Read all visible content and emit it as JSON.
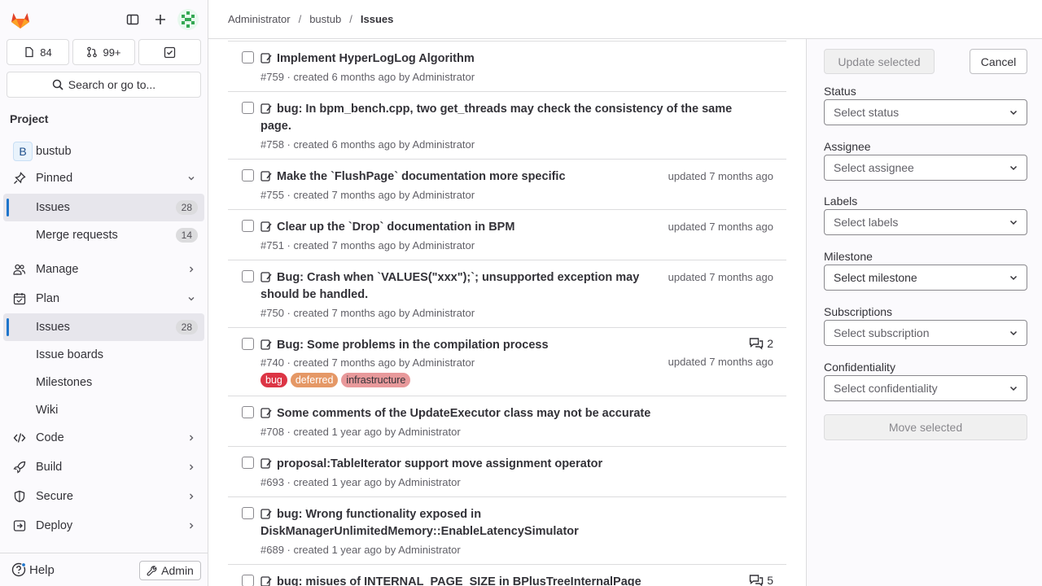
{
  "breadcrumb": {
    "items": [
      "Administrator",
      "bustub"
    ],
    "current": "Issues"
  },
  "counts": {
    "issues": "84",
    "merge_requests": "99+"
  },
  "search": {
    "label": "Search or go to..."
  },
  "sidebar": {
    "section_label": "Project",
    "project": {
      "avatar_letter": "B",
      "name": "bustub"
    },
    "pinned": {
      "label": "Pinned",
      "items": [
        {
          "label": "Issues",
          "count": "28"
        },
        {
          "label": "Merge requests",
          "count": "14"
        }
      ]
    },
    "manage": "Manage",
    "plan": {
      "label": "Plan",
      "items": [
        {
          "label": "Issues",
          "count": "28"
        },
        {
          "label": "Issue boards"
        },
        {
          "label": "Milestones"
        },
        {
          "label": "Wiki"
        }
      ]
    },
    "code": "Code",
    "build": "Build",
    "secure": "Secure",
    "deploy": "Deploy",
    "help": "Help",
    "admin": "Admin"
  },
  "issues": [
    {
      "title": "Implement HyperLogLog Algorithm",
      "meta": "#759 · created 6 months ago by Administrator"
    },
    {
      "title": "bug: In bpm_bench.cpp, two get_threads may check the consistency of the same page.",
      "meta": "#758 · created 6 months ago by Administrator"
    },
    {
      "title": "Make the `FlushPage` documentation more specific",
      "meta": "#755 · created 7 months ago by Administrator",
      "updated": "updated 7 months ago"
    },
    {
      "title": "Clear up the `Drop` documentation in BPM",
      "meta": "#751 · created 7 months ago by Administrator",
      "updated": "updated 7 months ago"
    },
    {
      "title": "Bug: Crash when `VALUES(\"xxx\");`; unsupported exception may should be handled.",
      "meta": "#750 · created 7 months ago by Administrator",
      "updated": "updated 7 months ago"
    },
    {
      "title": "Bug: Some problems in the compilation process",
      "meta": "#740 · created 7 months ago by Administrator",
      "updated": "updated 7 months ago",
      "comments": "2",
      "labels": [
        "bug",
        "deferred",
        "infrastructure"
      ]
    },
    {
      "title": "Some comments of the UpdateExecutor class may not be accurate",
      "meta": "#708 · created 1 year ago by Administrator"
    },
    {
      "title": "proposal:TableIterator support move assignment operator",
      "meta": "#693 · created 1 year ago by Administrator"
    },
    {
      "title": "bug: Wrong functionality exposed in DiskManagerUnlimitedMemory::EnableLatencySimulator",
      "meta": "#689 · created 1 year ago by Administrator"
    },
    {
      "title": "bug: misues of INTERNAL_PAGE_SIZE in BPlusTreeInternalPage",
      "comments": "5"
    }
  ],
  "label_colors": {
    "bug": "#dc3545",
    "deferred": "#e59866",
    "infrastructure": "#e8999b"
  },
  "panel": {
    "update_selected": "Update selected",
    "cancel": "Cancel",
    "fields": [
      {
        "label": "Status",
        "placeholder": "Select status"
      },
      {
        "label": "Assignee",
        "placeholder": "Select assignee"
      },
      {
        "label": "Labels",
        "placeholder": "Select labels"
      },
      {
        "label": "Milestone",
        "placeholder": "Select milestone"
      },
      {
        "label": "Subscriptions",
        "placeholder": "Select subscription"
      },
      {
        "label": "Confidentiality",
        "placeholder": "Select confidentiality"
      }
    ],
    "move_selected": "Move selected"
  }
}
